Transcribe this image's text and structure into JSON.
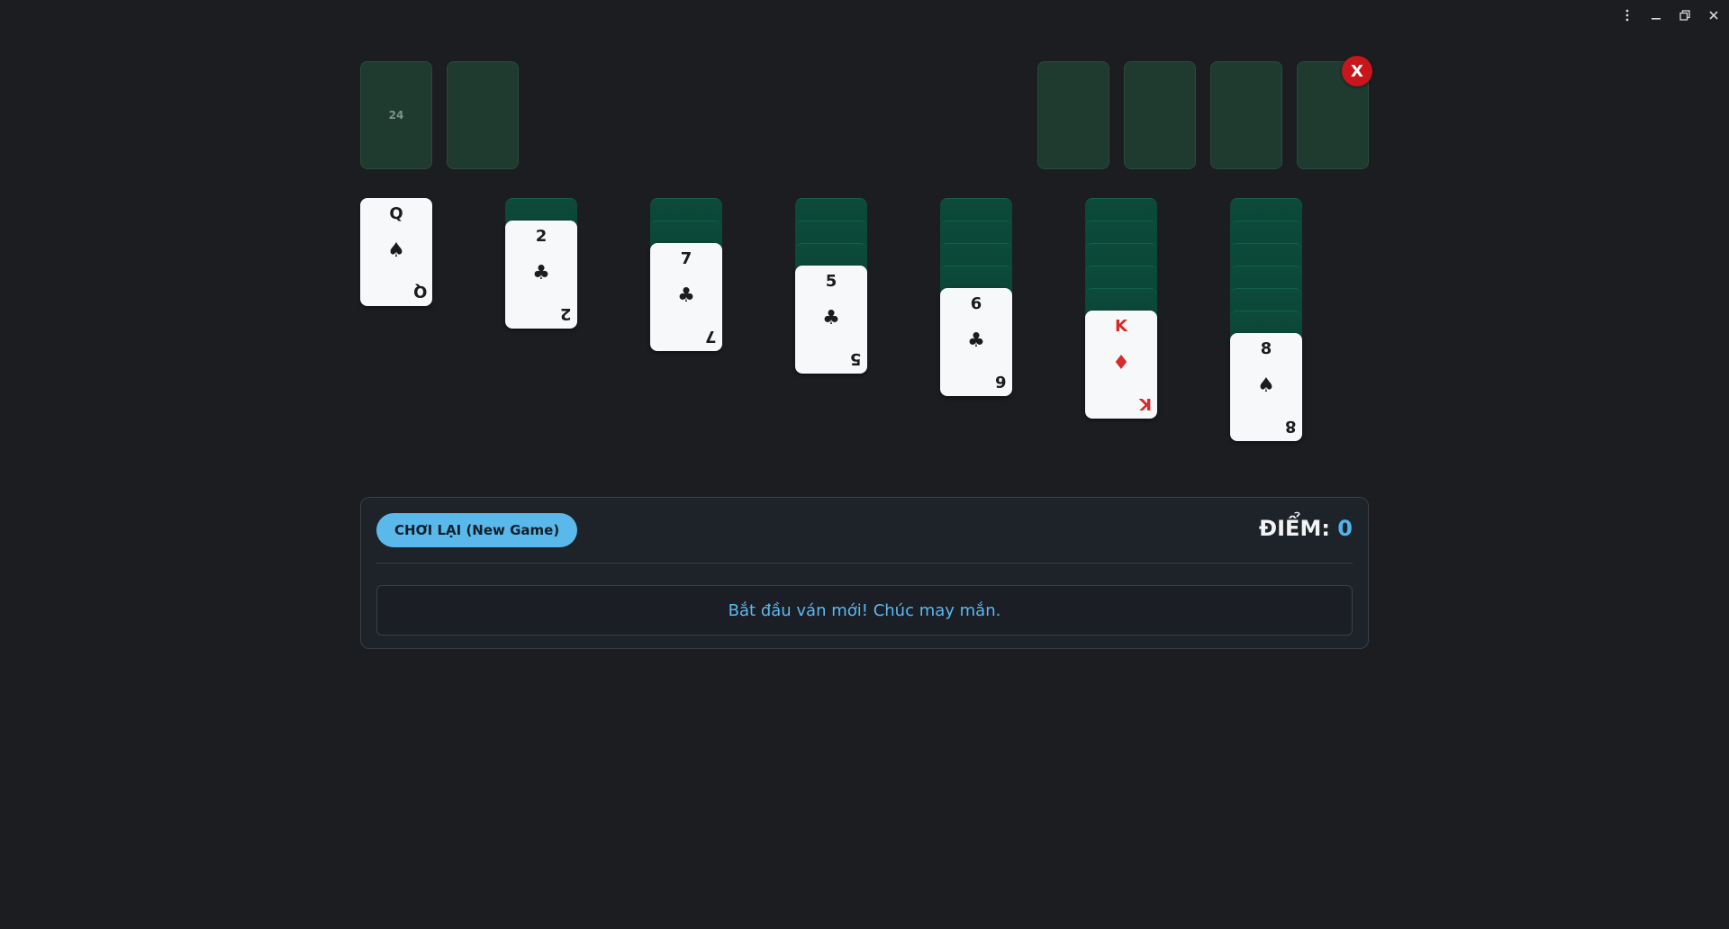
{
  "window": {
    "menu_icon": "kebab-menu-icon",
    "minimize_icon": "minimize-icon",
    "restore_icon": "restore-icon",
    "close_icon": "close-icon"
  },
  "stock": {
    "count": "24"
  },
  "close_badge": {
    "label": "X"
  },
  "tableau": [
    {
      "rank": "Q",
      "suit": "♠",
      "color": "black",
      "hidden": 0
    },
    {
      "rank": "2",
      "suit": "♣",
      "color": "black",
      "hidden": 1
    },
    {
      "rank": "7",
      "suit": "♣",
      "color": "black",
      "hidden": 2
    },
    {
      "rank": "5",
      "suit": "♣",
      "color": "black",
      "hidden": 3
    },
    {
      "rank": "6",
      "suit": "♣",
      "color": "black",
      "hidden": 4
    },
    {
      "rank": "K",
      "suit": "♦",
      "color": "red",
      "hidden": 5
    },
    {
      "rank": "8",
      "suit": "♠",
      "color": "black",
      "hidden": 6
    }
  ],
  "controls": {
    "new_game_label": "CHƠI LẠI (New Game)",
    "score_label": "ĐIỂM:",
    "score_value": "0",
    "message": "Bắt đầu ván mới! Chúc may mắn."
  },
  "colors": {
    "background": "#1b1d21",
    "slot": "#1f3a2f",
    "card_back": "#0c4a3a",
    "accent": "#5ab8ea",
    "red_suit": "#d72a2a",
    "badge": "#c8161d"
  }
}
